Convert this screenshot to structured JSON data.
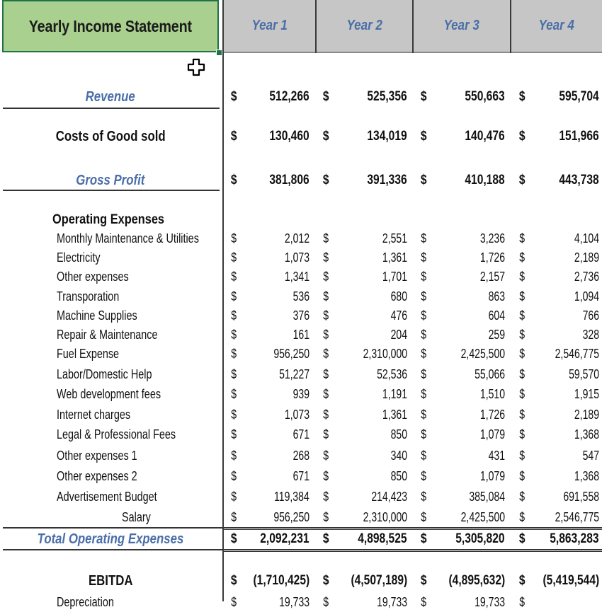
{
  "sheet": {
    "title": "Yearly Income Statement",
    "years": [
      "Year 1",
      "Year 2",
      "Year 3",
      "Year 4"
    ],
    "currency_symbol": "$",
    "colors": {
      "title_fill": "#a9d08e",
      "header_fill": "#c6c6c6",
      "accent_blue": "#4a6ea8",
      "selection_border": "#217346"
    }
  },
  "summary": {
    "revenue": {
      "label": "Revenue",
      "values": [
        "512,266",
        "525,356",
        "550,663",
        "595,704"
      ]
    },
    "cogs": {
      "label": "Costs of Good sold",
      "values": [
        "130,460",
        "134,019",
        "140,476",
        "151,966"
      ]
    },
    "gross_profit": {
      "label": "Gross Profit",
      "values": [
        "381,806",
        "391,336",
        "410,188",
        "443,738"
      ]
    }
  },
  "operating_expenses": {
    "heading": "Operating Expenses",
    "items": [
      {
        "label": "Monthly Maintenance & Utilities",
        "values": [
          "2,012",
          "2,551",
          "3,236",
          "4,104"
        ]
      },
      {
        "label": "Electricity",
        "values": [
          "1,073",
          "1,361",
          "1,726",
          "2,189"
        ]
      },
      {
        "label": "Other expenses",
        "values": [
          "1,341",
          "1,701",
          "2,157",
          "2,736"
        ]
      },
      {
        "label": "Transporation",
        "values": [
          "536",
          "680",
          "863",
          "1,094"
        ]
      },
      {
        "label": "Machine Supplies",
        "values": [
          "376",
          "476",
          "604",
          "766"
        ]
      },
      {
        "label": "Repair & Maintenance",
        "values": [
          "161",
          "204",
          "259",
          "328"
        ]
      },
      {
        "label": "Fuel Expense",
        "values": [
          "956,250",
          "2,310,000",
          "2,425,500",
          "2,546,775"
        ]
      },
      {
        "label": "Labor/Domestic Help",
        "values": [
          "51,227",
          "52,536",
          "55,066",
          "59,570"
        ]
      },
      {
        "label": "Web development fees",
        "values": [
          "939",
          "1,191",
          "1,510",
          "1,915"
        ]
      },
      {
        "label": "Internet charges",
        "values": [
          "1,073",
          "1,361",
          "1,726",
          "2,189"
        ]
      },
      {
        "label": "Legal & Professional Fees",
        "values": [
          "671",
          "850",
          "1,079",
          "1,368"
        ]
      },
      {
        "label": "Other expenses 1",
        "values": [
          "268",
          "340",
          "431",
          "547"
        ]
      },
      {
        "label": "Other expenses 2",
        "values": [
          "671",
          "850",
          "1,079",
          "1,368"
        ]
      },
      {
        "label": "Advertisement Budget",
        "values": [
          "119,384",
          "214,423",
          "385,084",
          "691,558"
        ]
      },
      {
        "label": "Salary",
        "values": [
          "956,250",
          "2,310,000",
          "2,425,500",
          "2,546,775"
        ]
      }
    ],
    "total": {
      "label": "Total Operating Expenses",
      "values": [
        "2,092,231",
        "4,898,525",
        "5,305,820",
        "5,863,283"
      ]
    }
  },
  "ebitda": {
    "label": "EBITDA",
    "values": [
      "(1,710,425)",
      "(4,507,189)",
      "(4,895,632)",
      "(5,419,544)"
    ]
  },
  "depreciation": {
    "label": "Depreciation",
    "values": [
      "19,733",
      "19,733",
      "19,733",
      ""
    ]
  }
}
